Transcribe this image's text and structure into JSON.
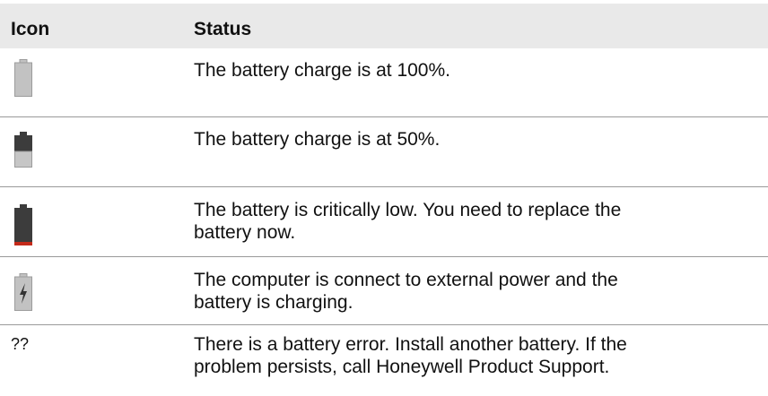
{
  "table": {
    "headers": {
      "icon": "Icon",
      "status": "Status"
    },
    "rows": [
      {
        "icon": "battery-full-icon",
        "status_lines": [
          "The battery charge is at 100%."
        ]
      },
      {
        "icon": "battery-half-icon",
        "status_lines": [
          "The battery charge is at 50%."
        ]
      },
      {
        "icon": "battery-critical-icon",
        "status_lines": [
          "The battery is critically low. You need to replace the",
          "battery now."
        ]
      },
      {
        "icon": "battery-charging-icon",
        "status_lines": [
          "The computer is connect to external power and the",
          "battery is charging."
        ]
      },
      {
        "icon_text": "??",
        "status_lines": [
          "There is a battery error. Install another battery. If the",
          "problem persists, call Honeywell Product Support."
        ]
      }
    ]
  },
  "colors": {
    "header_bg": "#e9e9e9",
    "battery_gray": "#c2c2c2",
    "battery_dark": "#3c3c3c",
    "battery_red": "#c42a1a",
    "divider": "#9a9a9a"
  }
}
